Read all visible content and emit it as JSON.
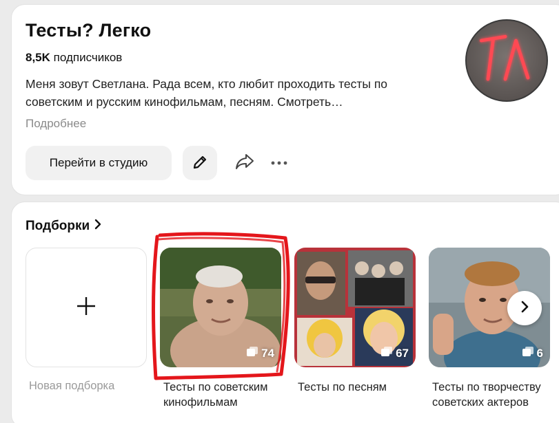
{
  "channel": {
    "title": "Тесты? Легко",
    "subscribers_count": "8,5K",
    "subscribers_label": "подписчиков",
    "description": "Меня зовут Светлана. Рада всем, кто любит проходить тесты по советским и русским кинофильмам, песням. Смотреть…",
    "more_label": "Подробнее",
    "avatar_text": "ТЛ"
  },
  "actions": {
    "studio_label": "Перейти в студию",
    "edit_icon": "pencil-icon",
    "share_icon": "share-arrow-icon",
    "more_icon": "more-dots-icon"
  },
  "collections": {
    "section_title": "Подборки",
    "new_label": "Новая подборка",
    "items": [
      {
        "label": "Тесты по советским кинофильмам",
        "count": "74"
      },
      {
        "label": "Тесты по песням",
        "count": "67"
      },
      {
        "label": "Тесты по творчеству советских актеров",
        "count": "6"
      }
    ]
  },
  "colors": {
    "accent_highlight": "#e4161b",
    "avatar_neon": "#ff4a52",
    "button_bg": "#f1f1f1"
  }
}
